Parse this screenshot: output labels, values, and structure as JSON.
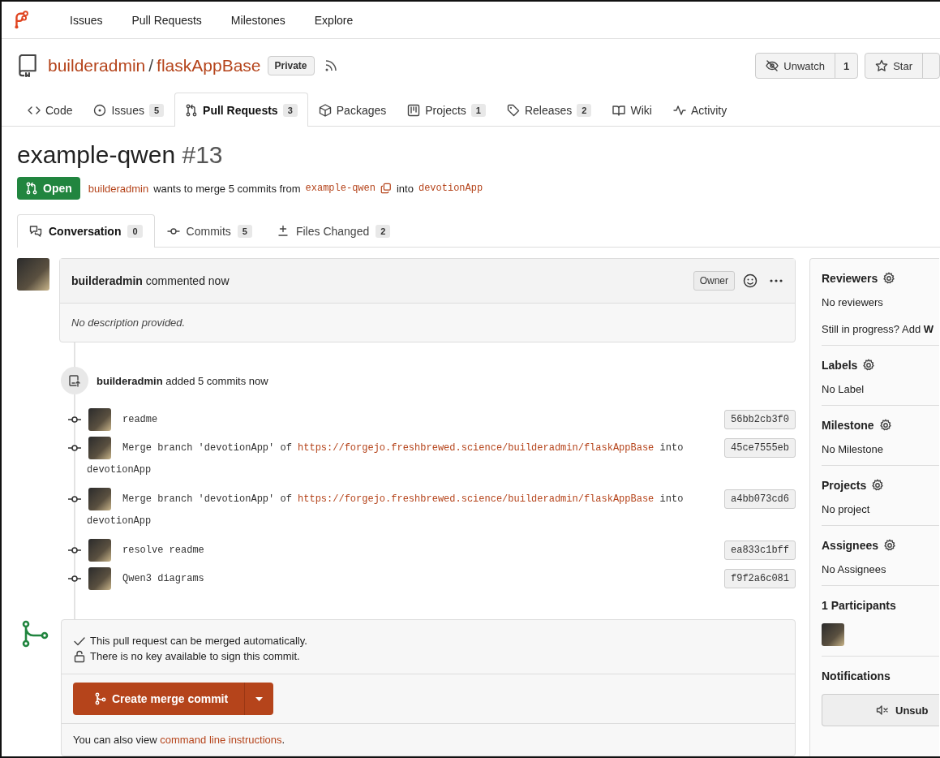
{
  "nav": {
    "items": [
      "Issues",
      "Pull Requests",
      "Milestones",
      "Explore"
    ]
  },
  "repo": {
    "owner": "builderadmin",
    "separator": "/",
    "name": "flaskAppBase",
    "visibility": "Private",
    "watch": {
      "label": "Unwatch",
      "count": "1"
    },
    "star": {
      "label": "Star"
    }
  },
  "repo_tabs": [
    {
      "label": "Code",
      "selected": false
    },
    {
      "label": "Issues",
      "count": "5",
      "selected": false
    },
    {
      "label": "Pull Requests",
      "count": "3",
      "selected": true
    },
    {
      "label": "Packages",
      "selected": false
    },
    {
      "label": "Projects",
      "count": "1",
      "selected": false
    },
    {
      "label": "Releases",
      "count": "2",
      "selected": false
    },
    {
      "label": "Wiki",
      "selected": false
    },
    {
      "label": "Activity",
      "selected": false
    }
  ],
  "pr": {
    "title": "example-qwen",
    "number": "#13",
    "state": "Open",
    "author": "builderadmin",
    "summary": "wants to merge 5 commits from",
    "head": "example-qwen",
    "into": "into",
    "base": "devotionApp"
  },
  "pr_tabs": [
    {
      "label": "Conversation",
      "count": "0",
      "selected": true
    },
    {
      "label": "Commits",
      "count": "5",
      "selected": false
    },
    {
      "label": "Files Changed",
      "count": "2",
      "selected": false
    }
  ],
  "comment": {
    "author": "builderadmin",
    "action": "commented now",
    "role": "Owner",
    "body": "No description provided."
  },
  "commit_event": {
    "author": "builderadmin",
    "action": "added 5 commits now"
  },
  "commits": [
    {
      "message": "readme",
      "sha": "56bb2cb3f0"
    },
    {
      "message": "Merge branch 'devotionApp' of",
      "link": "https://forgejo.freshbrewed.science/builderadmin/flaskAppBase",
      "tail": "into",
      "continuation": "devotionApp",
      "sha": "45ce7555eb"
    },
    {
      "message": "Merge branch 'devotionApp' of",
      "link": "https://forgejo.freshbrewed.science/builderadmin/flaskAppBase",
      "tail": "into",
      "continuation": "devotionApp",
      "sha": "a4bb073cd6"
    },
    {
      "message": "resolve readme",
      "sha": "ea833c1bff"
    },
    {
      "message": "Qwen3 diagrams",
      "sha": "f9f2a6c081"
    }
  ],
  "merge_box": {
    "checks": [
      "This pull request can be merged automatically.",
      "There is no key available to sign this commit."
    ],
    "button": "Create merge commit",
    "hint": "You can also view",
    "hint_link": "command line instructions",
    "hint_end": "."
  },
  "sidebar": {
    "sections": [
      {
        "kind": "setting",
        "title": "Reviewers",
        "lines": [
          "No reviewers",
          "Still in progress? Add **W**"
        ]
      },
      {
        "kind": "setting",
        "title": "Labels",
        "lines": [
          "No Label"
        ]
      },
      {
        "kind": "setting",
        "title": "Milestone",
        "lines": [
          "No Milestone"
        ]
      },
      {
        "kind": "setting",
        "title": "Projects",
        "lines": [
          "No project"
        ]
      },
      {
        "kind": "setting",
        "title": "Assignees",
        "lines": [
          "No Assignees"
        ]
      },
      {
        "kind": "participants",
        "title": "1 Participants"
      },
      {
        "kind": "notifications",
        "title": "Notifications",
        "button": "Unsub"
      }
    ]
  }
}
